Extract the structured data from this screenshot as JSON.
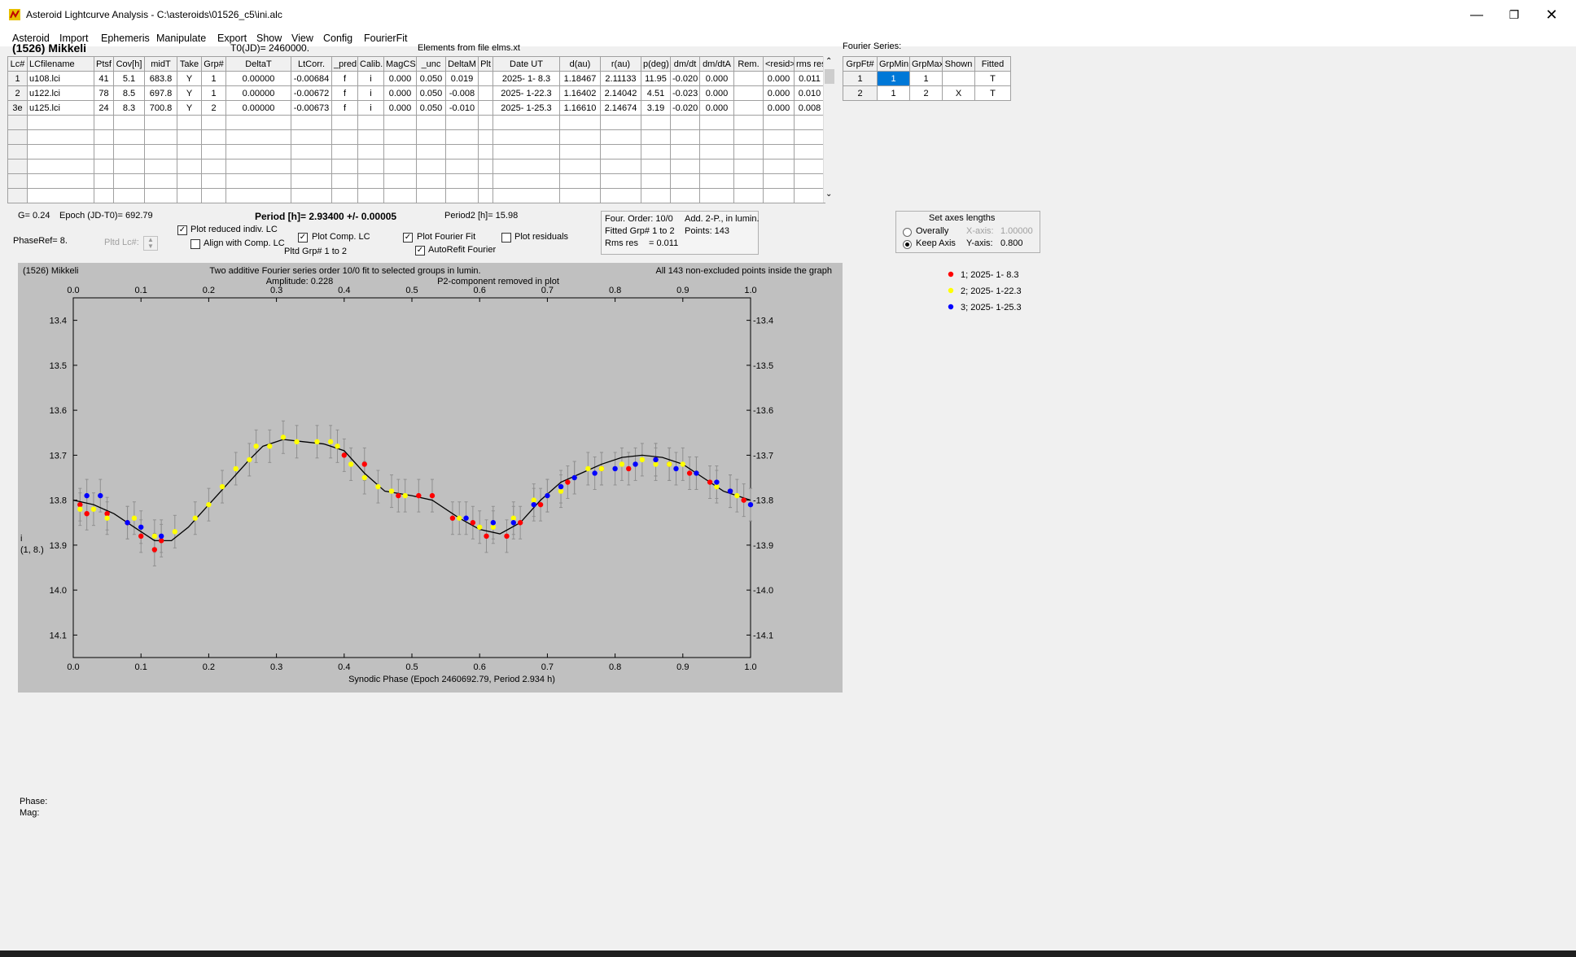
{
  "window": {
    "title": "Asteroid Lightcurve Analysis - C:\\asteroids\\01526_c5\\ini.alc"
  },
  "menu": [
    "Asteroid",
    "Import",
    "Ephemeris",
    "Manipulate",
    "Export",
    "Show",
    "View",
    "Config",
    "FourierFit"
  ],
  "header": {
    "asteroid": "(1526) Mikkeli",
    "t0": "T0(JD)= 2460000.",
    "elements": "Elements from file elms.xt"
  },
  "lc_table": {
    "columns": [
      "Lc#",
      "LCfilename",
      "Ptsf",
      "Cov[h]",
      "midT",
      "Take",
      "Grp#",
      "DeltaT",
      "LtCorr.",
      "_pred",
      "Calib.",
      "MagCS",
      "_unc",
      "DeltaM",
      "Plt",
      "Date UT",
      "d(au)",
      "r(au)",
      "p(deg)",
      "dm/dt",
      "dm/dtA",
      "Rem.",
      "<resid>",
      "rms res"
    ],
    "rows": [
      [
        "1",
        "u108.lci",
        "41",
        "5.1",
        "683.8",
        "Y",
        "1",
        "0.00000",
        "-0.00684",
        "f",
        "i",
        "0.000",
        "0.050",
        "0.019",
        "",
        "2025- 1- 8.3",
        "1.18467",
        "2.11133",
        "11.95",
        "-0.020",
        "0.000",
        "",
        "0.000",
        "0.011"
      ],
      [
        "2",
        "u122.lci",
        "78",
        "8.5",
        "697.8",
        "Y",
        "1",
        "0.00000",
        "-0.00672",
        "f",
        "i",
        "0.000",
        "0.050",
        "-0.008",
        "",
        "2025- 1-22.3",
        "1.16402",
        "2.14042",
        "4.51",
        "-0.023",
        "0.000",
        "",
        "0.000",
        "0.010"
      ],
      [
        "3e",
        "u125.lci",
        "24",
        "8.3",
        "700.8",
        "Y",
        "2",
        "0.00000",
        "-0.00673",
        "f",
        "i",
        "0.000",
        "0.050",
        "-0.010",
        "",
        "2025- 1-25.3",
        "1.16610",
        "2.14674",
        "3.19",
        "-0.020",
        "0.000",
        "",
        "0.000",
        "0.008"
      ]
    ]
  },
  "fourier": {
    "label": "Fourier Series:",
    "columns": [
      "GrpFt#",
      "GrpMin",
      "GrpMax",
      "Shown",
      "Fitted"
    ],
    "rows": [
      [
        "1",
        "1",
        "1",
        "",
        "T"
      ],
      [
        "2",
        "1",
        "2",
        "X",
        "T"
      ]
    ]
  },
  "controls": {
    "g": "G= 0.24",
    "epoch": "Epoch (JD-T0)= 692.79",
    "period": "Period [h]= 2.93400 +/- 0.00005",
    "period2": "Period2 [h]= 15.98",
    "phaseref": "PhaseRef= 8.",
    "pltdlc": "Pltd Lc#:",
    "plot_reduced": "Plot reduced indiv. LC",
    "align_comp": "Align with Comp. LC",
    "plot_comp": "Plot Comp. LC",
    "pltd_grp": "Pltd Grp#  1  to  2",
    "plot_fourier": "Plot Fourier Fit",
    "autorefit": "AutoRefit Fourier",
    "plot_residuals": "Plot residuals",
    "info1": "Four. Order: 10/0",
    "info2": "Add. 2-P., in lumin.",
    "info3": "Fitted Grp# 1 to 2",
    "info4": "Points: 143",
    "info5": "Rms res",
    "info6": "= 0.011",
    "axes_title": "Set axes lengths",
    "overally": "Overally",
    "keep_axis": "Keep Axis",
    "xaxis_label": "X-axis:",
    "xaxis_val": "1.00000",
    "yaxis_label": "Y-axis:",
    "yaxis_val": "0.800"
  },
  "chart_data": {
    "type": "scatter",
    "title": "(1526) Mikkeli",
    "subtitle1": "Two additive Fourier series order 10/0 fit to selected groups in lumin.",
    "subtitle2": "Amplitude: 0.228",
    "subtitle3": "P2-component removed in plot",
    "note": "All 143 non-excluded points inside the graph",
    "xlabel": "Synodic Phase (Epoch 2460692.79, Period 2.934 h)",
    "ylabel": "i",
    "ylabel2": "(1, 8.)",
    "xlim": [
      0.0,
      1.0
    ],
    "ylim": [
      14.15,
      13.35
    ],
    "xticks": [
      "0.0",
      "0.1",
      "0.2",
      "0.3",
      "0.4",
      "0.5",
      "0.6",
      "0.7",
      "0.8",
      "0.9",
      "1.0"
    ],
    "yticks": [
      "13.4",
      "13.5",
      "13.6",
      "13.7",
      "13.8",
      "13.9",
      "14.0",
      "14.1"
    ],
    "legend": [
      "1; 2025- 1- 8.3",
      "2; 2025- 1-22.3",
      "3; 2025- 1-25.3"
    ],
    "colors": [
      "#ff0000",
      "#ffff00",
      "#0000ff"
    ],
    "fit_curve": [
      [
        0.0,
        13.8
      ],
      [
        0.03,
        13.81
      ],
      [
        0.06,
        13.83
      ],
      [
        0.09,
        13.86
      ],
      [
        0.12,
        13.89
      ],
      [
        0.145,
        13.89
      ],
      [
        0.17,
        13.86
      ],
      [
        0.2,
        13.81
      ],
      [
        0.23,
        13.76
      ],
      [
        0.26,
        13.71
      ],
      [
        0.28,
        13.68
      ],
      [
        0.31,
        13.665
      ],
      [
        0.34,
        13.67
      ],
      [
        0.37,
        13.675
      ],
      [
        0.4,
        13.69
      ],
      [
        0.43,
        13.74
      ],
      [
        0.46,
        13.78
      ],
      [
        0.5,
        13.79
      ],
      [
        0.53,
        13.8
      ],
      [
        0.57,
        13.84
      ],
      [
        0.6,
        13.865
      ],
      [
        0.63,
        13.875
      ],
      [
        0.66,
        13.85
      ],
      [
        0.69,
        13.8
      ],
      [
        0.72,
        13.76
      ],
      [
        0.75,
        13.74
      ],
      [
        0.78,
        13.72
      ],
      [
        0.81,
        13.705
      ],
      [
        0.84,
        13.7
      ],
      [
        0.87,
        13.705
      ],
      [
        0.9,
        13.72
      ],
      [
        0.93,
        13.75
      ],
      [
        0.96,
        13.78
      ],
      [
        1.0,
        13.8
      ]
    ],
    "series": [
      {
        "name": "1; 2025- 1- 8.3",
        "values": [
          [
            0.01,
            13.81
          ],
          [
            0.02,
            13.83
          ],
          [
            0.05,
            13.83
          ],
          [
            0.08,
            13.85
          ],
          [
            0.1,
            13.88
          ],
          [
            0.12,
            13.91
          ],
          [
            0.13,
            13.89
          ],
          [
            0.4,
            13.7
          ],
          [
            0.43,
            13.72
          ],
          [
            0.48,
            13.79
          ],
          [
            0.51,
            13.79
          ],
          [
            0.53,
            13.79
          ],
          [
            0.56,
            13.84
          ],
          [
            0.59,
            13.85
          ],
          [
            0.61,
            13.88
          ],
          [
            0.64,
            13.88
          ],
          [
            0.66,
            13.85
          ],
          [
            0.69,
            13.81
          ],
          [
            0.73,
            13.76
          ],
          [
            0.78,
            13.73
          ],
          [
            0.82,
            13.73
          ],
          [
            0.86,
            13.71
          ],
          [
            0.88,
            13.72
          ],
          [
            0.91,
            13.74
          ],
          [
            0.94,
            13.76
          ],
          [
            0.97,
            13.78
          ],
          [
            0.99,
            13.8
          ]
        ]
      },
      {
        "name": "2; 2025- 1-22.3",
        "values": [
          [
            0.01,
            13.82
          ],
          [
            0.03,
            13.82
          ],
          [
            0.05,
            13.84
          ],
          [
            0.09,
            13.84
          ],
          [
            0.12,
            13.88
          ],
          [
            0.15,
            13.87
          ],
          [
            0.18,
            13.84
          ],
          [
            0.2,
            13.81
          ],
          [
            0.22,
            13.77
          ],
          [
            0.24,
            13.73
          ],
          [
            0.26,
            13.71
          ],
          [
            0.27,
            13.68
          ],
          [
            0.29,
            13.68
          ],
          [
            0.31,
            13.66
          ],
          [
            0.33,
            13.67
          ],
          [
            0.36,
            13.67
          ],
          [
            0.38,
            13.67
          ],
          [
            0.39,
            13.68
          ],
          [
            0.41,
            13.72
          ],
          [
            0.43,
            13.75
          ],
          [
            0.45,
            13.77
          ],
          [
            0.47,
            13.78
          ],
          [
            0.49,
            13.79
          ],
          [
            0.57,
            13.84
          ],
          [
            0.6,
            13.86
          ],
          [
            0.62,
            13.86
          ],
          [
            0.65,
            13.84
          ],
          [
            0.68,
            13.8
          ],
          [
            0.7,
            13.79
          ],
          [
            0.72,
            13.78
          ],
          [
            0.74,
            13.75
          ],
          [
            0.76,
            13.73
          ],
          [
            0.78,
            13.73
          ],
          [
            0.81,
            13.72
          ],
          [
            0.84,
            13.71
          ],
          [
            0.86,
            13.72
          ],
          [
            0.88,
            13.72
          ],
          [
            0.9,
            13.72
          ],
          [
            0.92,
            13.74
          ],
          [
            0.95,
            13.77
          ],
          [
            0.98,
            13.79
          ]
        ]
      },
      {
        "name": "3; 2025- 1-25.3",
        "values": [
          [
            0.02,
            13.79
          ],
          [
            0.04,
            13.79
          ],
          [
            0.08,
            13.85
          ],
          [
            0.1,
            13.86
          ],
          [
            0.13,
            13.88
          ],
          [
            0.58,
            13.84
          ],
          [
            0.62,
            13.85
          ],
          [
            0.65,
            13.85
          ],
          [
            0.68,
            13.81
          ],
          [
            0.7,
            13.79
          ],
          [
            0.72,
            13.77
          ],
          [
            0.74,
            13.75
          ],
          [
            0.77,
            13.74
          ],
          [
            0.8,
            13.73
          ],
          [
            0.83,
            13.72
          ],
          [
            0.86,
            13.71
          ],
          [
            0.89,
            13.73
          ],
          [
            0.92,
            13.74
          ],
          [
            0.95,
            13.76
          ],
          [
            0.97,
            13.78
          ],
          [
            1.0,
            13.81
          ]
        ]
      }
    ]
  },
  "status": {
    "phase": "Phase:",
    "mag": "Mag:"
  }
}
